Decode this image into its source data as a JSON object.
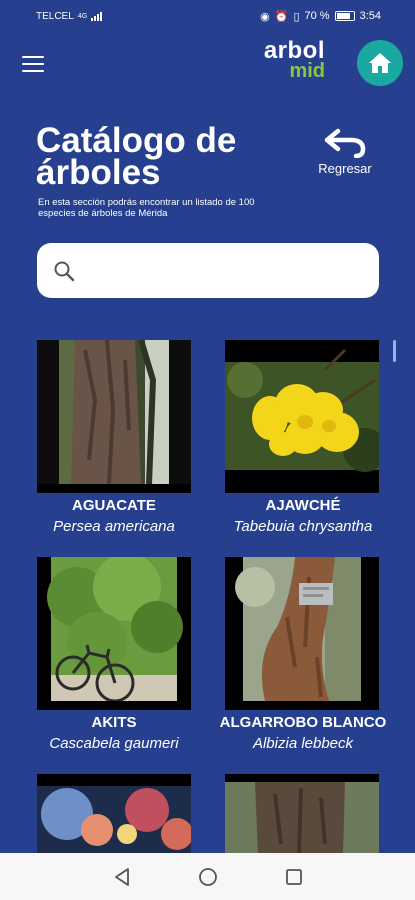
{
  "status_bar": {
    "carrier": "TELCEL",
    "network": "4G",
    "battery": "70 %",
    "time": "3:54"
  },
  "header": {
    "logo_line1": "arbol",
    "logo_line2": "mid",
    "menu_icon": "hamburger-menu-icon",
    "home_icon": "home-icon"
  },
  "page": {
    "title_line1": "Catálogo de",
    "title_line2": "árboles",
    "description": "En esta sección podrás encontrar un listado de 100 especies de árboles de Mérida",
    "back_label": "Regresar"
  },
  "search": {
    "placeholder": "",
    "value": ""
  },
  "trees": [
    {
      "name": "AGUACATE",
      "scientific": "Persea americana"
    },
    {
      "name": "AJAWCHÉ",
      "scientific": "Tabebuia chrysantha"
    },
    {
      "name": "AKITS",
      "scientific": "Cascabela gaumeri"
    },
    {
      "name": "ALGARROBO BLANCO",
      "scientific": "Albizia lebbeck"
    }
  ],
  "colors": {
    "background": "#26408f",
    "accent_teal": "#1aa9a0",
    "logo_green": "#8cc63f"
  }
}
